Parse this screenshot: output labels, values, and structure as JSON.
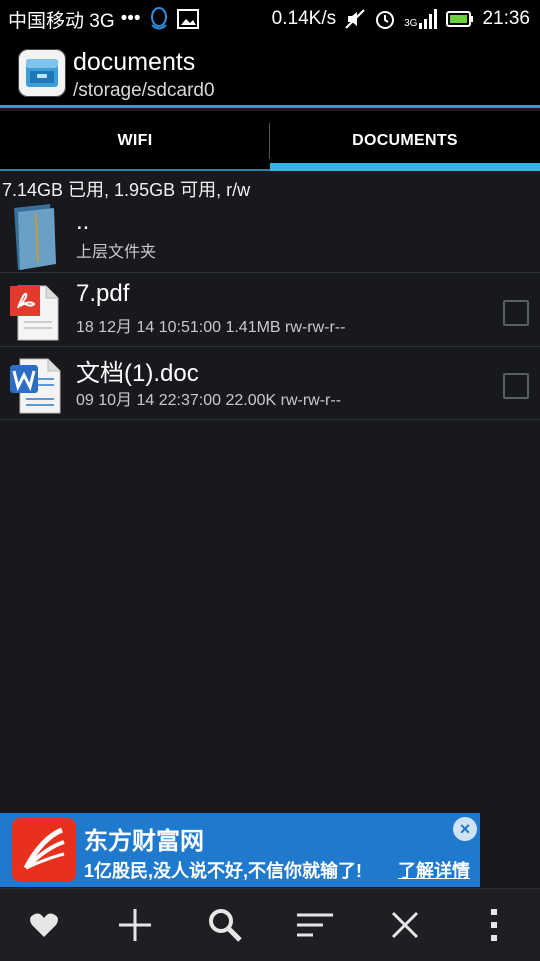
{
  "status_bar": {
    "carrier": "中国移动 3G",
    "dots": "•••",
    "speed": "0.14K/s",
    "signal_label": "3G",
    "time": "21:36"
  },
  "app_bar": {
    "title": "documents",
    "path": "/storage/sdcard0",
    "icon": "file-manager-icon"
  },
  "tabs": [
    {
      "label": "WIFI",
      "active": false
    },
    {
      "label": "DOCUMENTS",
      "active": true
    }
  ],
  "storage_info": "7.14GB 已用, 1.95GB 可用, r/w",
  "files": [
    {
      "name": "..",
      "meta": "上层文件夹",
      "icon": "folder-icon",
      "checkbox": false
    },
    {
      "name": "7.pdf",
      "meta": "18 12月 14 10:51:00  1.41MB  rw-rw-r--",
      "icon": "pdf-file-icon",
      "checkbox": true
    },
    {
      "name": "文档(1).doc",
      "meta": "09 10月 14 22:37:00  22.00K  rw-rw-r--",
      "icon": "word-file-icon",
      "checkbox": true
    }
  ],
  "ad": {
    "title": "东方财富网",
    "text": "1亿股民,没人说不好,不信你就输了!",
    "link": "了解详情"
  },
  "bottom_bar": [
    "heart-icon",
    "add-icon",
    "search-icon",
    "sort-icon",
    "close-icon",
    "overflow-menu-icon"
  ],
  "colors": {
    "accent": "#33b5e5",
    "ad_blue": "#1f79cc",
    "ad_red": "#e8301f"
  }
}
